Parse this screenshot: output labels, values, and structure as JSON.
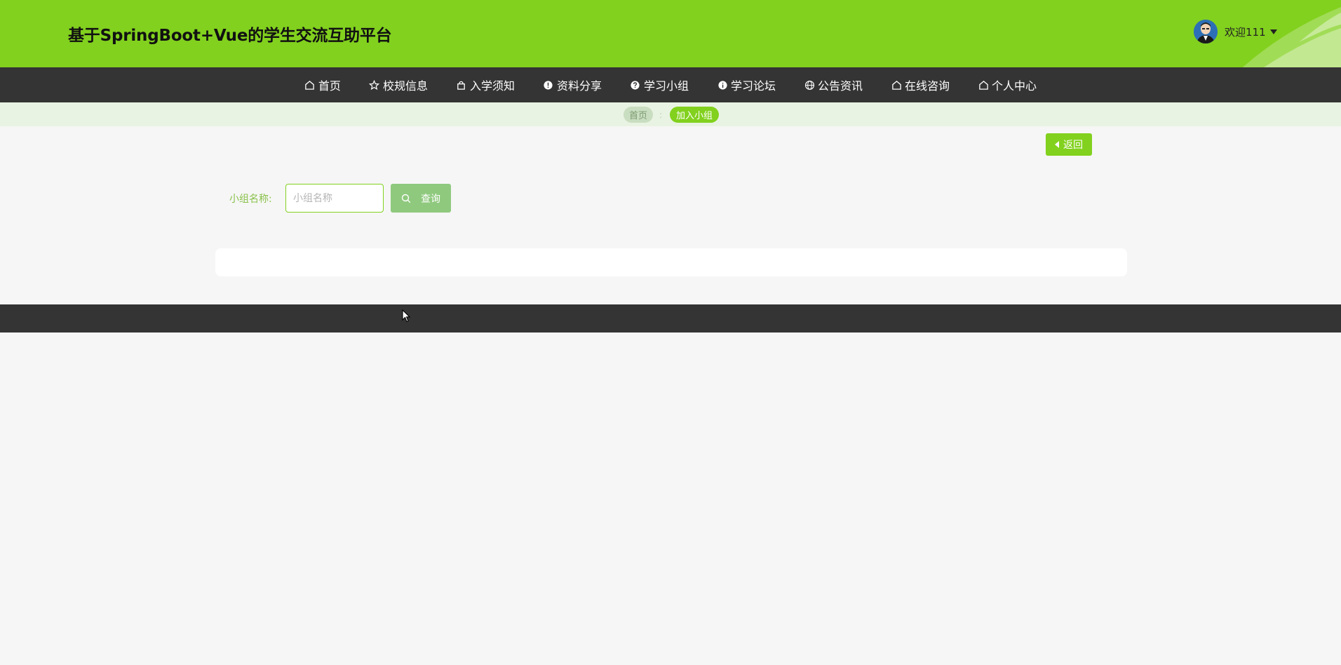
{
  "header": {
    "title": "基于SpringBoot+Vue的学生交流互助平台",
    "welcome": "欢迎111",
    "avatar_icon": "user-avatar",
    "caret_icon": "caret-down-icon"
  },
  "nav": {
    "items": [
      {
        "label": "首页",
        "icon": "home-icon"
      },
      {
        "label": "校规信息",
        "icon": "star-icon"
      },
      {
        "label": "入学须知",
        "icon": "bag-icon"
      },
      {
        "label": "资料分享",
        "icon": "warning-icon"
      },
      {
        "label": "学习小组",
        "icon": "question-icon"
      },
      {
        "label": "学习论坛",
        "icon": "info-icon"
      },
      {
        "label": "公告资讯",
        "icon": "globe-icon"
      },
      {
        "label": "在线咨询",
        "icon": "home-icon"
      },
      {
        "label": "个人中心",
        "icon": "home-icon"
      }
    ]
  },
  "breadcrumb": {
    "home": "首页",
    "separator": ":",
    "current": "加入小组"
  },
  "back_button": {
    "label": "返回"
  },
  "search": {
    "label": "小组名称:",
    "placeholder": "小组名称",
    "value": "",
    "button_label": "查询"
  },
  "colors": {
    "primary": "#82d11e",
    "nav_bg": "#343434",
    "page_bg": "#f6f6f6",
    "breadcrumb_bg": "#e9f3e3",
    "search_button": "#8fc97e"
  }
}
